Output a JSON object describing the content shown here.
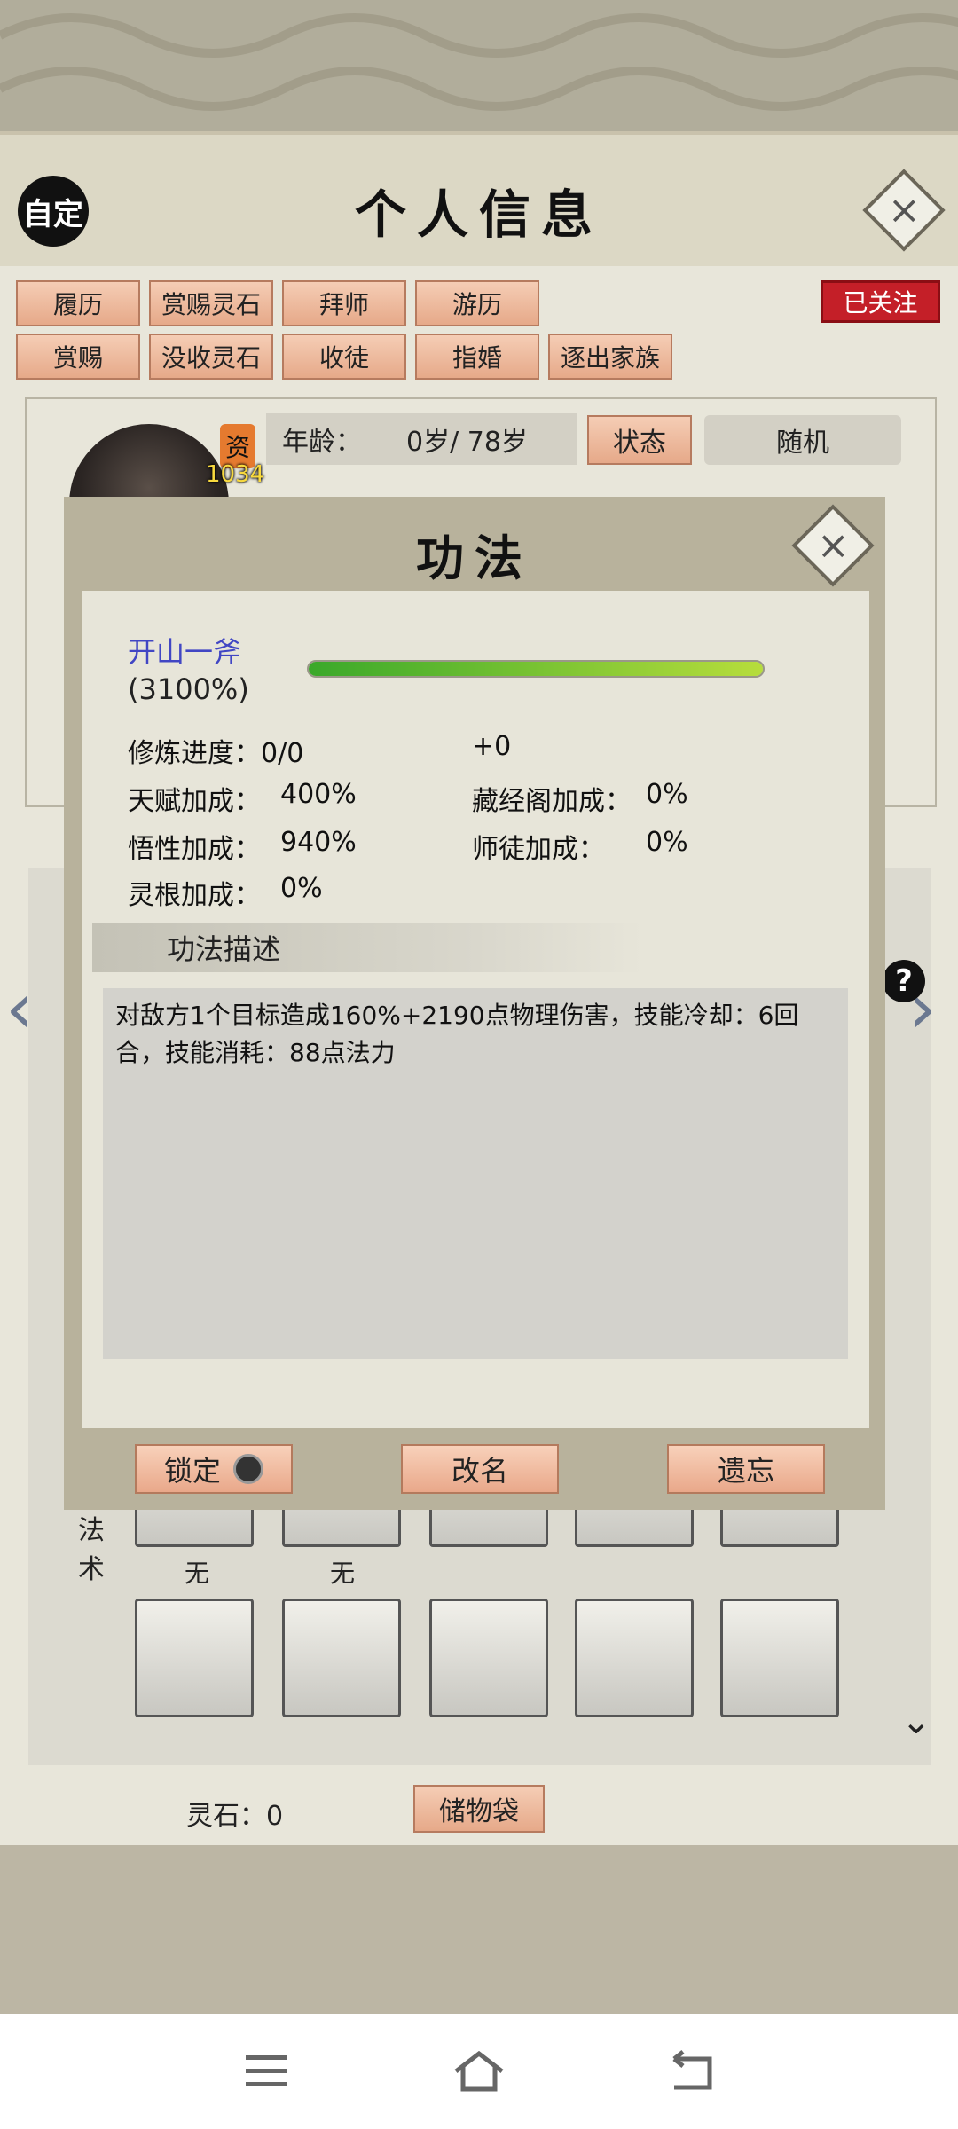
{
  "header": {
    "title": "个人信息",
    "custom_label": "自定"
  },
  "actions_row1": [
    "履历",
    "赏赐灵石",
    "拜师",
    "游历"
  ],
  "actions_row2": [
    "赏赐",
    "没收灵石",
    "收徒",
    "指婚",
    "逐出家族"
  ],
  "follow_label": "已关注",
  "profile": {
    "zi_badge": "资",
    "zi_value": "1034",
    "age_label": "年龄：",
    "age_value": "0岁/ 78岁",
    "status_label": "状态",
    "random_label": "随机"
  },
  "skills_section": {
    "label_line1": "法",
    "label_line2": "术",
    "slot_labels": [
      "无",
      "无"
    ]
  },
  "footer": {
    "spirit_stone": "灵石：0",
    "bag_label": "储物袋"
  },
  "modal": {
    "title": "功法",
    "skill_name": "开山一斧",
    "proficiency": "(3100%)",
    "progress": 1.0,
    "stats": {
      "practice": "修炼进度：0/0",
      "plus": "+0",
      "talent": "天赋加成：",
      "talent_value": "400%",
      "library": "藏经阁加成：",
      "library_value": "0%",
      "insight": "悟性加成：",
      "insight_value": "940%",
      "mentor": "师徒加成：",
      "mentor_value": "0%",
      "root": "灵根加成：",
      "root_value": "0%"
    },
    "desc_header": "功法描述",
    "description": "对敌方1个目标造成160%+2190点物理伤害，技能冷却：6回合，技能消耗：88点法力",
    "buttons": {
      "lock": "锁定",
      "rename": "改名",
      "forget": "遗忘"
    }
  },
  "help_label": "?",
  "colors": {
    "accent_button": "#e6a989",
    "follow_red": "#c41f28",
    "skill_name": "#4146c4",
    "progress_green": "#3aa82a"
  }
}
